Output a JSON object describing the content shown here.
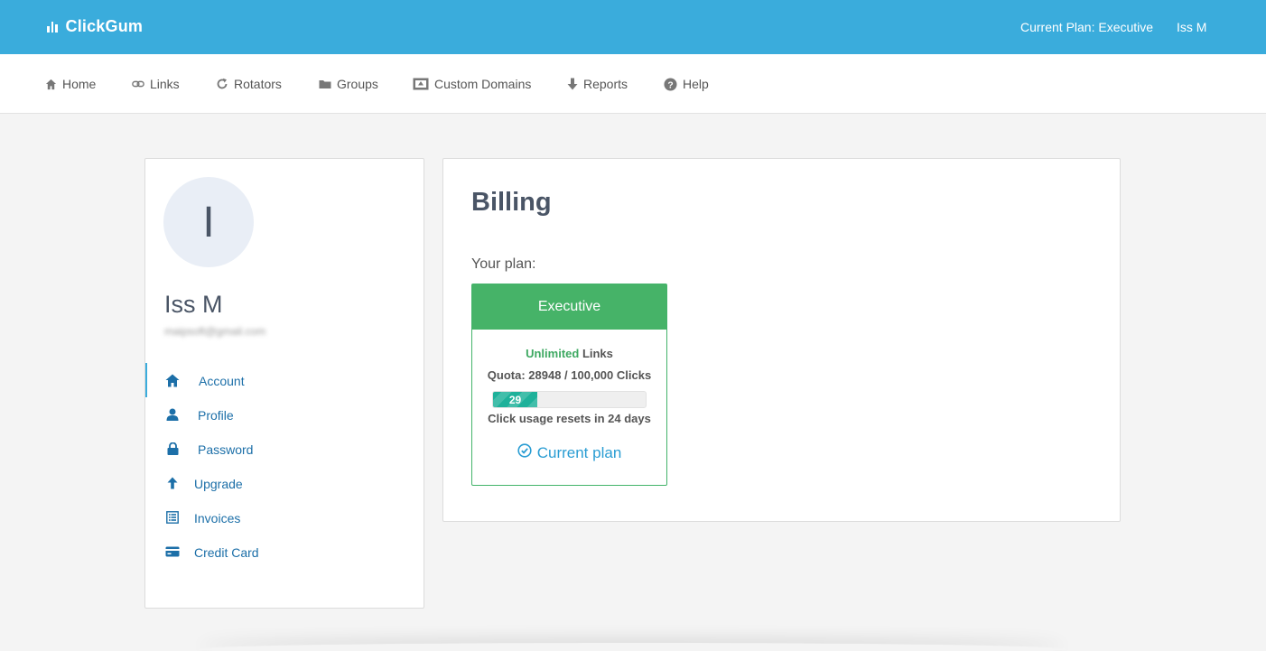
{
  "header": {
    "brand": "ClickGum",
    "plan_label": "Current Plan: Executive",
    "user": "Iss M",
    "color": "#3aacdc"
  },
  "nav": {
    "items": [
      {
        "label": "Home",
        "icon": "home-icon"
      },
      {
        "label": "Links",
        "icon": "link-icon"
      },
      {
        "label": "Rotators",
        "icon": "refresh-icon"
      },
      {
        "label": "Groups",
        "icon": "folder-icon"
      },
      {
        "label": "Custom Domains",
        "icon": "domain-icon"
      },
      {
        "label": "Reports",
        "icon": "download-icon"
      },
      {
        "label": "Help",
        "icon": "help-icon"
      }
    ]
  },
  "sidebar": {
    "avatar_initial": "I",
    "name": "Iss M",
    "email": "maipsoft@gmail.com",
    "menu": [
      {
        "label": "Account",
        "icon": "home-icon",
        "active": true
      },
      {
        "label": "Profile",
        "icon": "user-icon"
      },
      {
        "label": "Password",
        "icon": "lock-icon"
      },
      {
        "label": "Upgrade",
        "icon": "arrow-up-icon"
      },
      {
        "label": "Invoices",
        "icon": "list-icon"
      },
      {
        "label": "Credit Card",
        "icon": "credit-card-icon"
      }
    ],
    "link_color": "#1c6fa8"
  },
  "billing": {
    "title": "Billing",
    "plan_intro": "Your plan:",
    "plan": {
      "name": "Executive",
      "links_highlight": "Unlimited",
      "links_suffix": " Links",
      "quota": "Quota: 28948 / 100,000 Clicks",
      "usage_percent": 29,
      "usage_label": "29",
      "reset": "Click usage resets in 24 days",
      "status": "Current plan",
      "header_color": "#46b368"
    }
  }
}
